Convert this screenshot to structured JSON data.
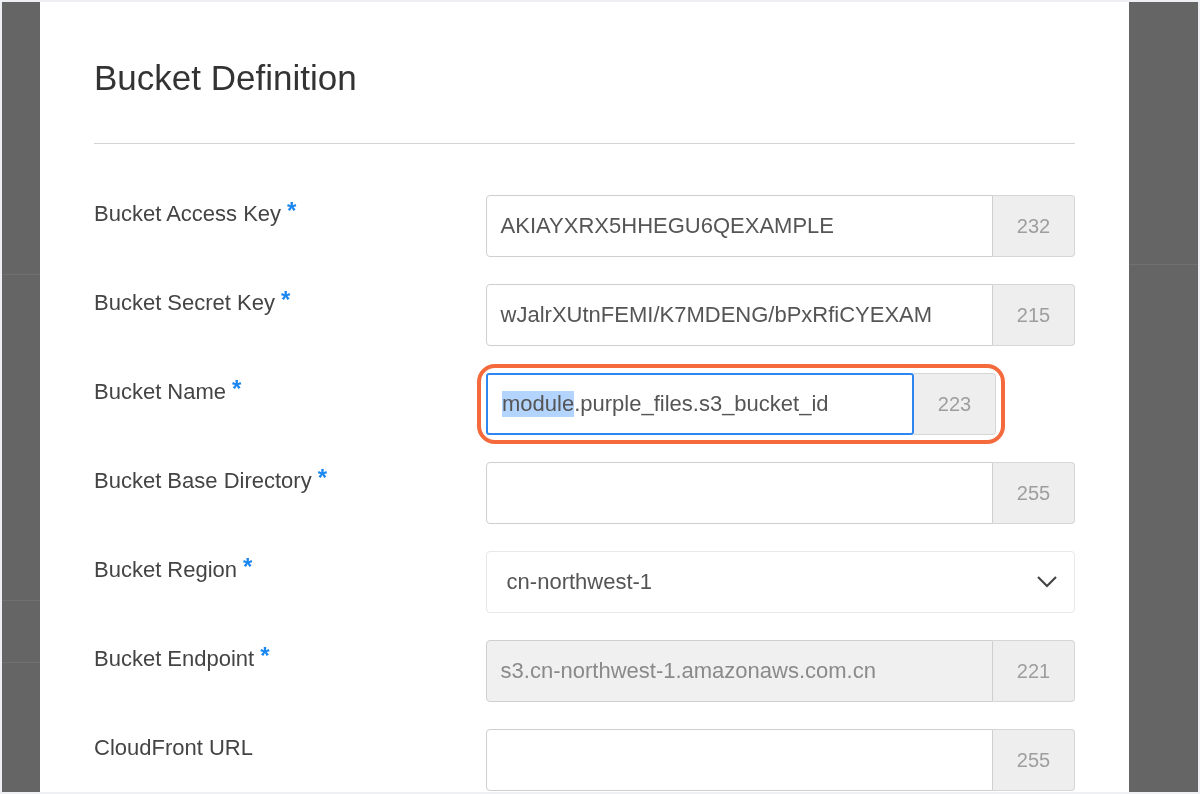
{
  "dialog": {
    "title": "Bucket Definition",
    "fields": [
      {
        "label": "Bucket Access Key",
        "required_mark": "*",
        "kind": "text",
        "value": "AKIAYXRX5HHEGU6QEXAMPLE",
        "counter": "232",
        "highlighted": false
      },
      {
        "label": "Bucket Secret Key",
        "required_mark": "*",
        "kind": "text",
        "value": "wJalrXUtnFEMI/K7MDENG/bPxRfiCYEXAM",
        "counter": "215",
        "highlighted": false
      },
      {
        "label": "Bucket Name",
        "required_mark": "*",
        "kind": "text",
        "selected_text": "module",
        "value": ".purple_files.s3_bucket_id",
        "counter": "223",
        "highlighted": true
      },
      {
        "label": "Bucket Base Directory",
        "required_mark": "*",
        "kind": "text",
        "counter": "255",
        "highlighted": false
      },
      {
        "label": "Bucket Region",
        "required_mark": "*",
        "kind": "select",
        "value": "cn-northwest-1",
        "highlighted": false
      },
      {
        "label": "Bucket Endpoint",
        "required_mark": "*",
        "kind": "locked",
        "value": "s3.cn-northwest-1.amazonaws.com.cn",
        "counter": "221",
        "highlighted": false
      },
      {
        "label": "CloudFront URL",
        "kind": "text",
        "counter": "255",
        "highlighted": false
      }
    ]
  }
}
